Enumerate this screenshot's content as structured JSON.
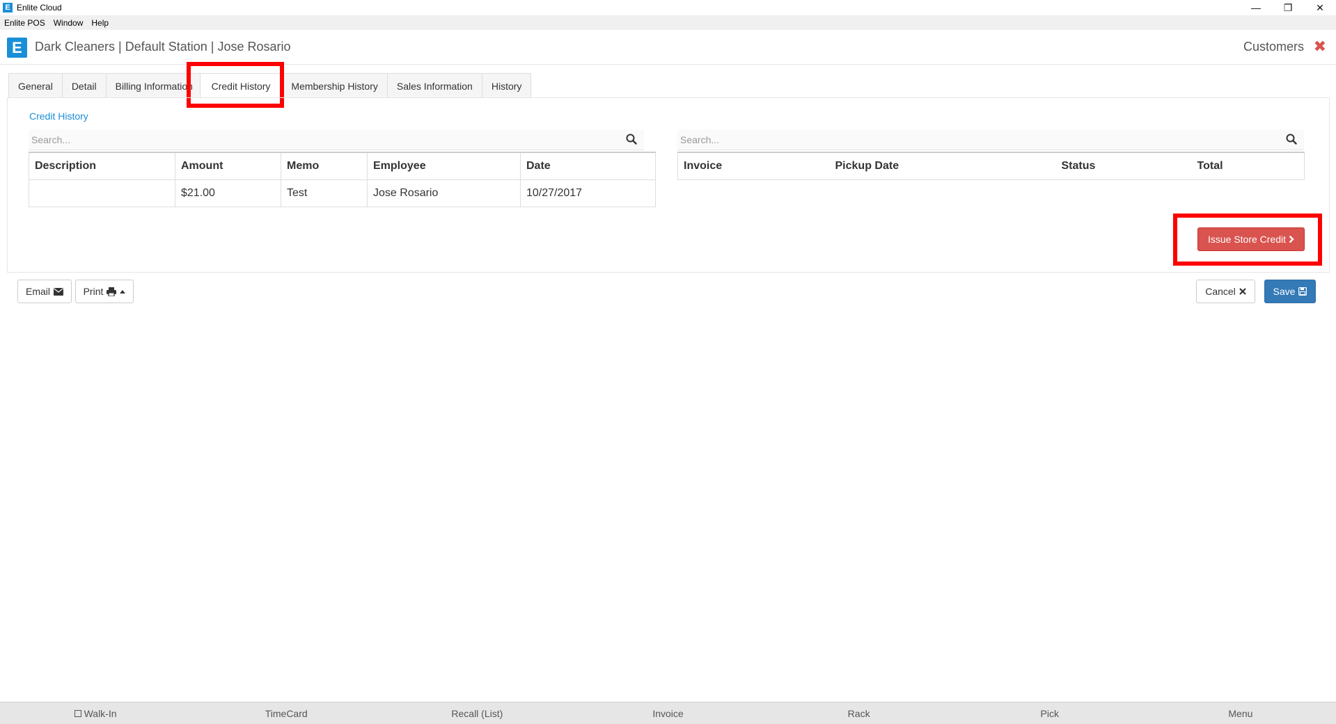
{
  "window": {
    "title": "Enlite Cloud",
    "app_icon_letter": "E",
    "controls": [
      "—",
      "❐",
      "✕"
    ]
  },
  "menubar": [
    "Enlite POS",
    "Window",
    "Help"
  ],
  "header": {
    "logo_letter": "E",
    "title": "Dark Cleaners | Default Station | Jose Rosario",
    "module": "Customers",
    "close_glyph": "✖"
  },
  "tabs": [
    {
      "label": "General",
      "active": false
    },
    {
      "label": "Detail",
      "active": false
    },
    {
      "label": "Billing Information",
      "active": false
    },
    {
      "label": "Credit History",
      "active": true
    },
    {
      "label": "Membership History",
      "active": false
    },
    {
      "label": "Sales Information",
      "active": false
    },
    {
      "label": "History",
      "active": false
    }
  ],
  "credit_panel": {
    "link": "Credit History",
    "left_search_placeholder": "Search...",
    "right_search_placeholder": "Search...",
    "credits_table": {
      "columns": [
        "Description",
        "Amount",
        "Memo",
        "Employee",
        "Date"
      ],
      "rows": [
        [
          "",
          "$21.00",
          "Test",
          "Jose Rosario",
          "10/27/2017"
        ]
      ]
    },
    "invoices_table": {
      "columns": [
        "Invoice",
        "Pickup Date",
        "Status",
        "Total"
      ],
      "rows": []
    },
    "issue_button": "Issue Store Credit"
  },
  "actions": {
    "email": "Email",
    "print": "Print",
    "cancel": "Cancel",
    "save": "Save"
  },
  "bottombar": [
    "Walk-In",
    "TimeCard",
    "Recall (List)",
    "Invoice",
    "Rack",
    "Pick",
    "Menu"
  ],
  "colors": {
    "brand": "#1a8fd8",
    "danger": "#d9534f",
    "primary": "#337ab7",
    "highlight": "#ff0000"
  }
}
